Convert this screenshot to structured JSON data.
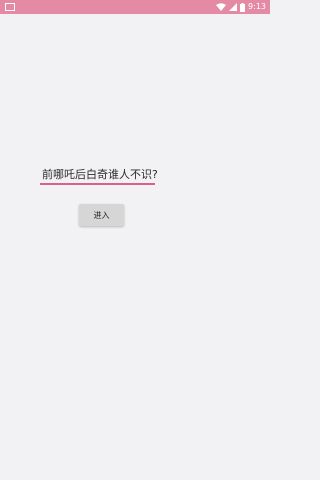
{
  "status_bar": {
    "time": "9:13",
    "icons": [
      "notification-icon",
      "wifi-icon",
      "signal-icon",
      "battery-icon"
    ],
    "color": "#e48aa5"
  },
  "main": {
    "question_text": "前哪吒后白奇谁人不识?",
    "underline_color": "#d9608a",
    "enter_button_label": "进入"
  }
}
